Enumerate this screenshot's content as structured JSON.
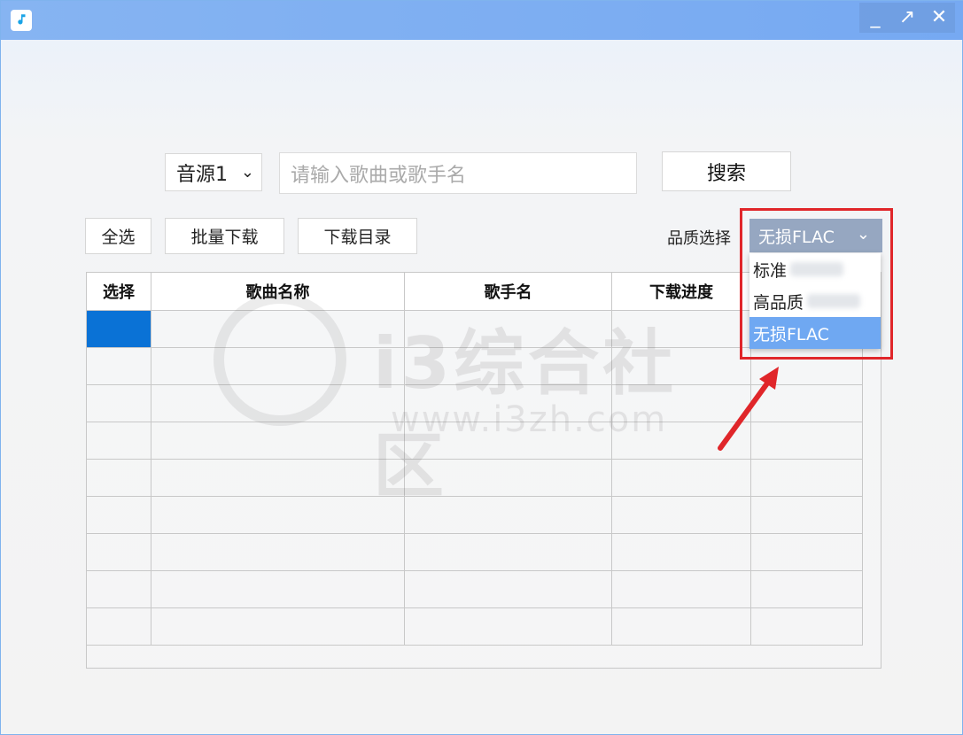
{
  "window": {
    "controls": [
      "_",
      "↗",
      "✕"
    ]
  },
  "search": {
    "source": "音源1",
    "placeholder": "请输入歌曲或歌手名",
    "button": "搜索"
  },
  "toolbar": {
    "select_all": "全选",
    "batch_download": "批量下载",
    "download_dir": "下载目录",
    "quality_label": "品质选择"
  },
  "quality": {
    "selected": "无损FLAC",
    "options": [
      "标准",
      "高品质",
      "无损FLAC"
    ]
  },
  "table": {
    "headers": [
      "选择",
      "歌曲名称",
      "歌手名",
      "下载进度",
      ""
    ]
  },
  "watermark": {
    "text": "i3综合社区",
    "url": "www.i3zh.com"
  },
  "colors": {
    "accent": "#0a72d6",
    "titlebar": "#7eaff2",
    "highlight": "#e0262a",
    "dropdown": "#96a7c1"
  }
}
